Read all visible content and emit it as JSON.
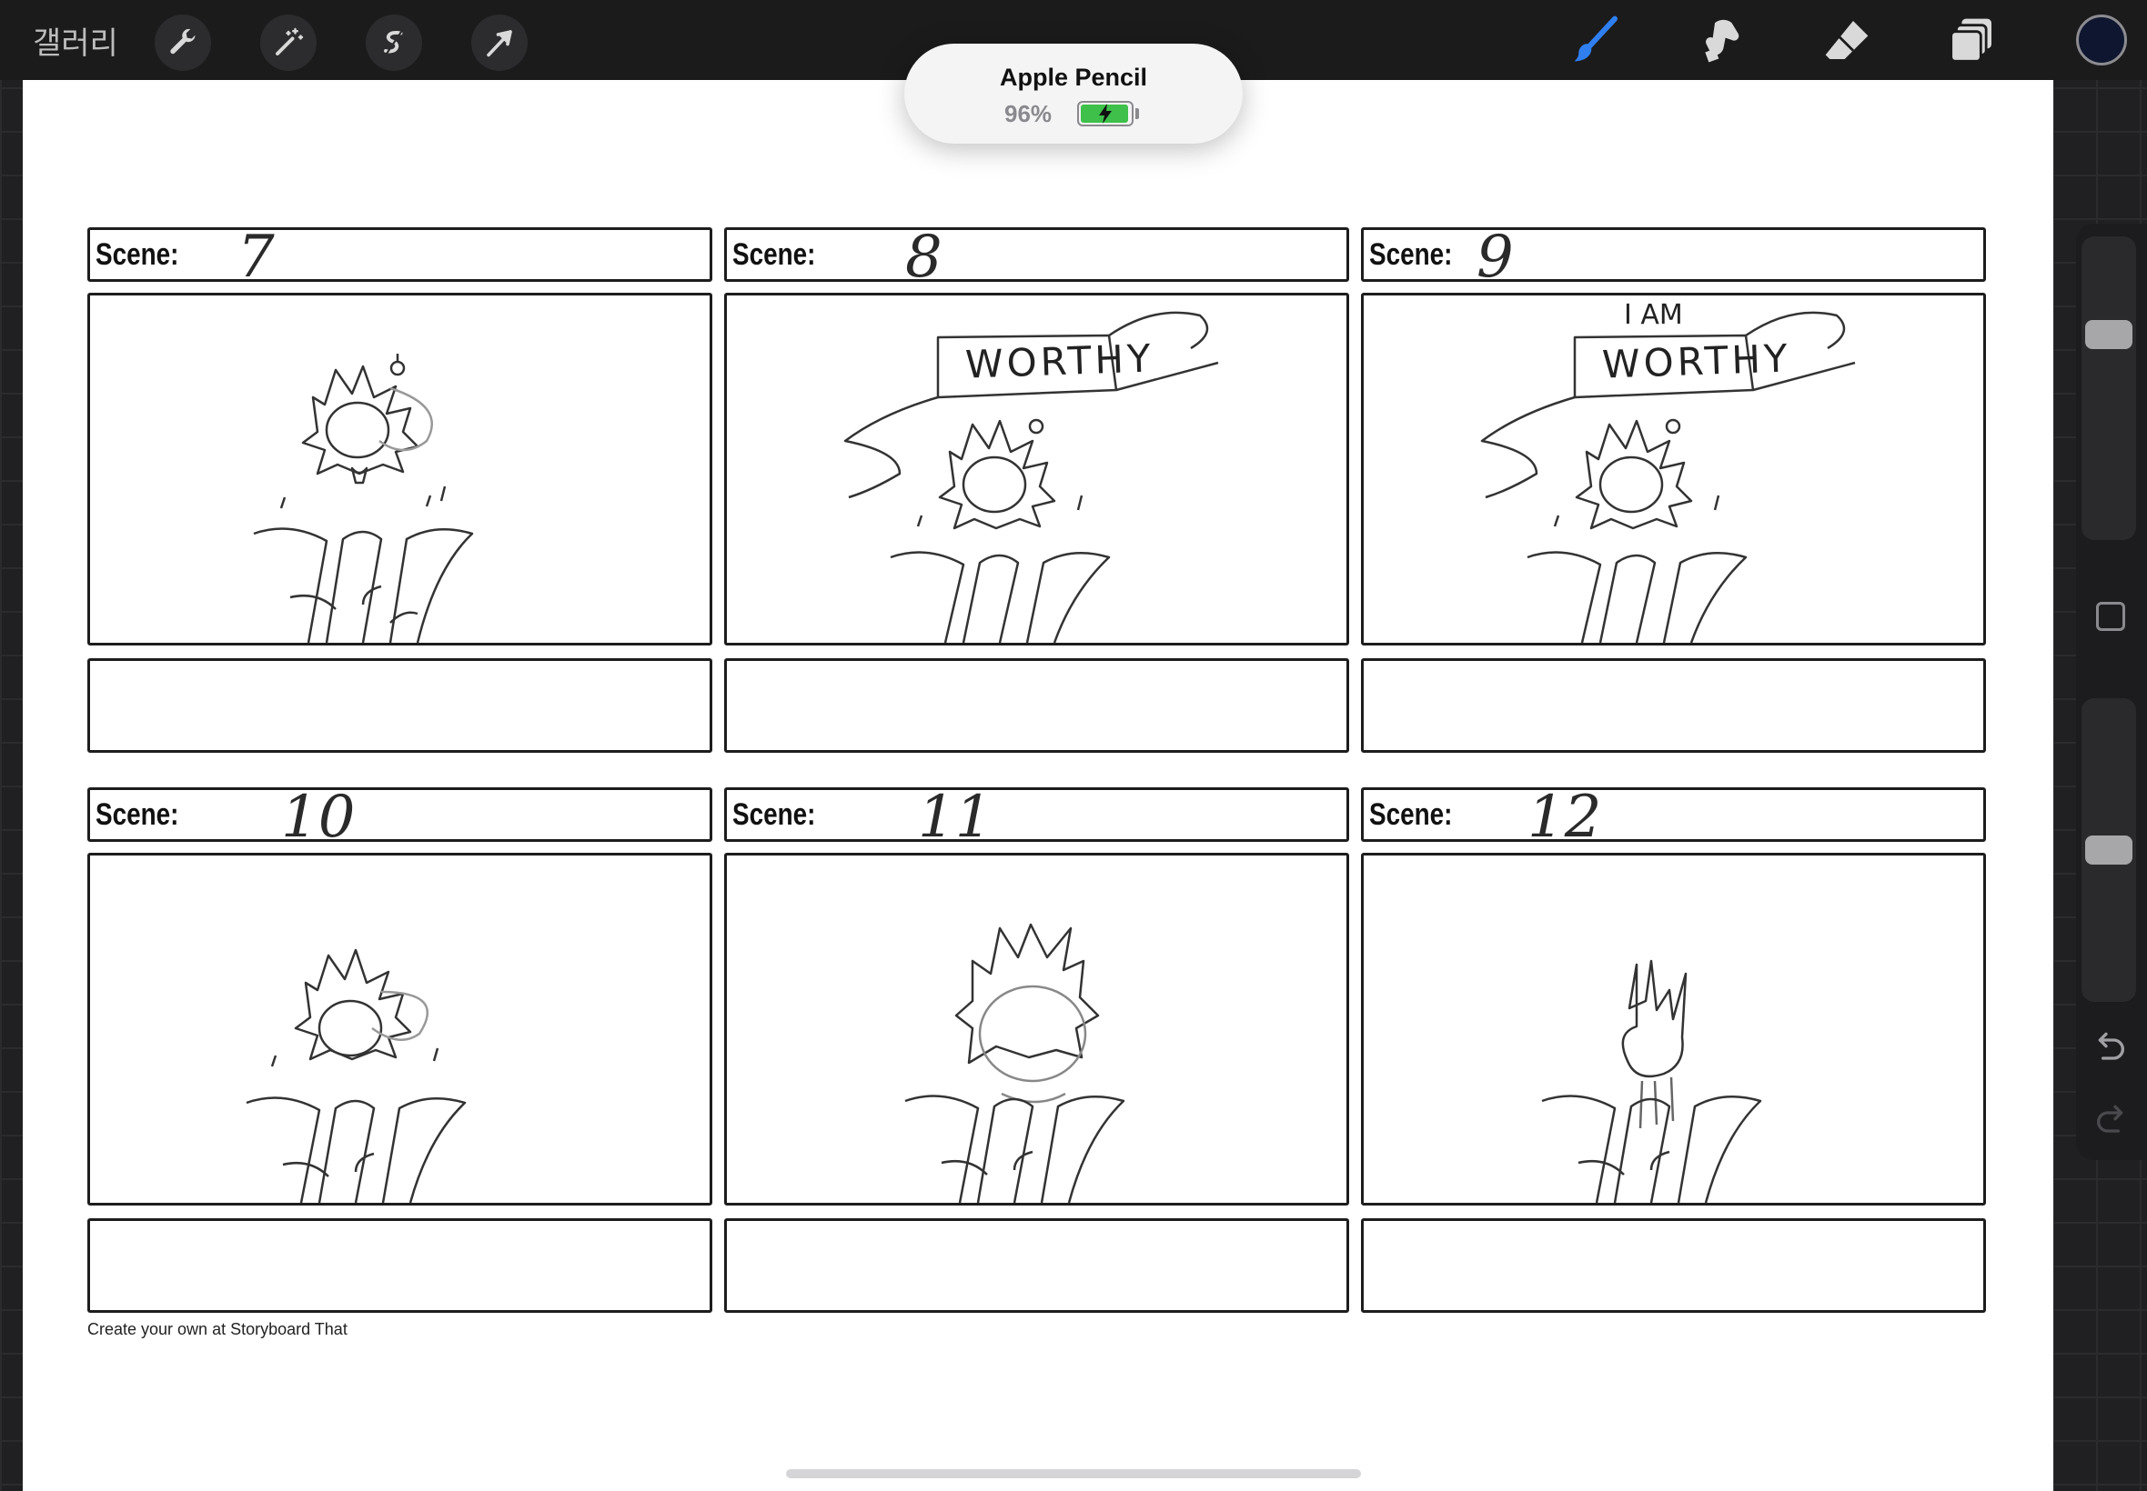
{
  "toolbar": {
    "gallery_label": "갤러리",
    "left_tools": [
      "wrench-icon",
      "magic-wand-icon",
      "selection-s-icon",
      "transform-arrow-icon"
    ],
    "right_tools": [
      "brush-icon",
      "smudge-icon",
      "eraser-icon",
      "layers-icon"
    ],
    "active_tool": "brush",
    "accent_color": "#2f7ff0",
    "current_color": "#0f1730"
  },
  "pencil_status": {
    "device": "Apple Pencil",
    "battery_text": "96%",
    "battery_level": 0.96,
    "charging": true,
    "battery_color": "#3ec04a"
  },
  "storyboard": {
    "scene_label": "Scene:",
    "cells": [
      {
        "number": "7",
        "art": "flame-skull-ribbon"
      },
      {
        "number": "8",
        "art": "flame-skull-banner",
        "banner": "WORTHY"
      },
      {
        "number": "9",
        "art": "flame-skull-banner",
        "banner": "WORTHY",
        "banner_top": "I AM"
      },
      {
        "number": "10",
        "art": "flame-skull-ribbon"
      },
      {
        "number": "11",
        "art": "flame-skull"
      },
      {
        "number": "12",
        "art": "flame-small"
      }
    ],
    "footer": "Create your own at Storyboard That"
  },
  "sidebar": {
    "brush_size": 0.7,
    "opacity": 0.5,
    "undo_icon": "undo-icon",
    "redo_icon": "redo-icon"
  }
}
